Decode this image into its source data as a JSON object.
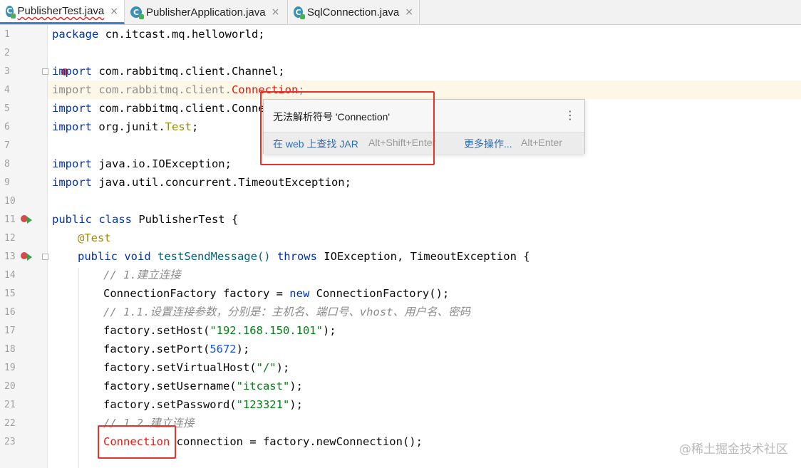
{
  "tabs": [
    {
      "label": "PublisherTest.java",
      "icon": "java-class-icon",
      "active": true
    },
    {
      "label": "PublisherApplication.java",
      "icon": "java-class-icon",
      "active": false
    },
    {
      "label": "SqlConnection.java",
      "icon": "java-class-icon",
      "active": false
    }
  ],
  "tab_close": "×",
  "line_numbers": [
    "1",
    "2",
    "3",
    "4",
    "5",
    "6",
    "7",
    "8",
    "9",
    "10",
    "11",
    "12",
    "13",
    "14",
    "15",
    "16",
    "17",
    "18",
    "19",
    "20",
    "21",
    "22",
    "23"
  ],
  "code": {
    "l1_kw": "package",
    "l1_rest": " cn.itcast.mq.helloworld;",
    "l3_kw": "import",
    "l3_rest": " com.rabbitmq.client.Channel;",
    "l4_kw": "import",
    "l4_mid": " com.rabbitmq.client.",
    "l4_err": "Connection",
    "l4_end": ";",
    "l5_kw": "import",
    "l5_rest": " com.rabbitmq.client.ConnectionFactory;",
    "l6_kw": "import",
    "l6_mid": " org.junit.",
    "l6_ann": "Test",
    "l6_end": ";",
    "l8_kw": "import",
    "l8_rest": " java.io.IOException;",
    "l9_kw": "import",
    "l9_rest": " java.util.concurrent.TimeoutException;",
    "l11_kw": "public class",
    "l11_rest": " PublisherTest {",
    "l12_ann": "@Test",
    "l13_kw": "public void",
    "l13_name": " testSendMessage()",
    "l13_kw2": " throws",
    "l13_rest": " IOException, TimeoutException {",
    "l14_cmt": "// 1.建立连接",
    "l15_a": "ConnectionFactory factory = ",
    "l15_kw": "new",
    "l15_b": " ConnectionFactory();",
    "l16_cmt": "// 1.1.设置连接参数，分别是：主机名、端口号、vhost、用户名、密码",
    "l17_a": "factory.setHost(",
    "l17_str": "\"192.168.150.101\"",
    "l17_b": ");",
    "l18_a": "factory.setPort(",
    "l18_num": "5672",
    "l18_b": ");",
    "l19_a": "factory.setVirtualHost(",
    "l19_str": "\"/\"",
    "l19_b": ");",
    "l20_a": "factory.setUsername(",
    "l20_str": "\"itcast\"",
    "l20_b": ");",
    "l21_a": "factory.setPassword(",
    "l21_str": "\"123321\"",
    "l21_b": ");",
    "l22_cmt": "// 1.2.建立连接",
    "l23_err": "Connection",
    "l23_rest": " connection = factory.newConnection();"
  },
  "popup": {
    "message": "无法解析符号 'Connection'",
    "action1_label": "在 web 上查找 JAR",
    "action1_shortcut": "Alt+Shift+Enter",
    "action2_label": "更多操作...",
    "action2_shortcut": "Alt+Enter",
    "menu_icon": "⋮"
  },
  "watermark": "@稀土掘金技术社区",
  "colors": {
    "keyword": "#0033b3",
    "error": "#e2170d",
    "string": "#067d17",
    "annotation": "#9e880d",
    "highlight_box": "#e5322d"
  }
}
